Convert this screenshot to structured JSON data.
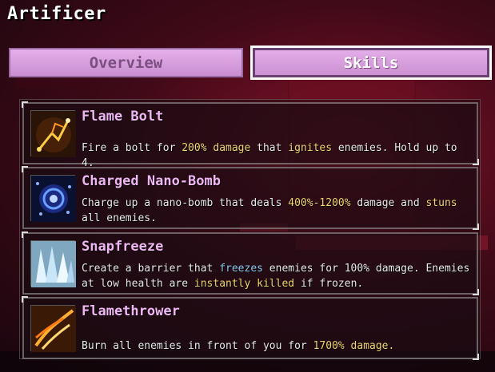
{
  "header": {
    "title": "Artificer"
  },
  "tabs": [
    {
      "label": "Overview",
      "selected": false
    },
    {
      "label": "Skills",
      "selected": true
    }
  ],
  "colors": {
    "skill_name": "#f0b6f4",
    "damage_highlight": "#f3d36b",
    "freeze_highlight": "#8ec6f0",
    "tab_fill": "#d79fdd"
  },
  "skills": [
    {
      "name": "Flame Bolt",
      "icon": "flame-bolt-icon",
      "desc": [
        {
          "text": "Fire a bolt for ",
          "style": "plain"
        },
        {
          "text": "200% damage",
          "style": "damage"
        },
        {
          "text": " that ",
          "style": "plain"
        },
        {
          "text": "ignites",
          "style": "damage"
        },
        {
          "text": " enemies. Hold up to 4.",
          "style": "plain"
        }
      ]
    },
    {
      "name": "Charged Nano-Bomb",
      "icon": "nano-bomb-icon",
      "desc": [
        {
          "text": "Charge up a nano-bomb that deals ",
          "style": "plain"
        },
        {
          "text": "400%-1200%",
          "style": "damage"
        },
        {
          "text": " damage and ",
          "style": "plain"
        },
        {
          "text": "stuns",
          "style": "damage"
        },
        {
          "text": " all enemies.",
          "style": "plain"
        }
      ]
    },
    {
      "name": "Snapfreeze",
      "icon": "snapfreeze-icon",
      "desc": [
        {
          "text": "Create a barrier that ",
          "style": "plain"
        },
        {
          "text": "freezes",
          "style": "cold"
        },
        {
          "text": " enemies for 100% damage. Enemies at low health are ",
          "style": "plain"
        },
        {
          "text": "instantly killed",
          "style": "damage"
        },
        {
          "text": " if frozen.",
          "style": "plain"
        }
      ]
    },
    {
      "name": "Flamethrower",
      "icon": "flamethrower-icon",
      "desc": [
        {
          "text": "Burn all enemies in front of you for ",
          "style": "plain"
        },
        {
          "text": "1700% damage.",
          "style": "damage"
        }
      ]
    }
  ]
}
